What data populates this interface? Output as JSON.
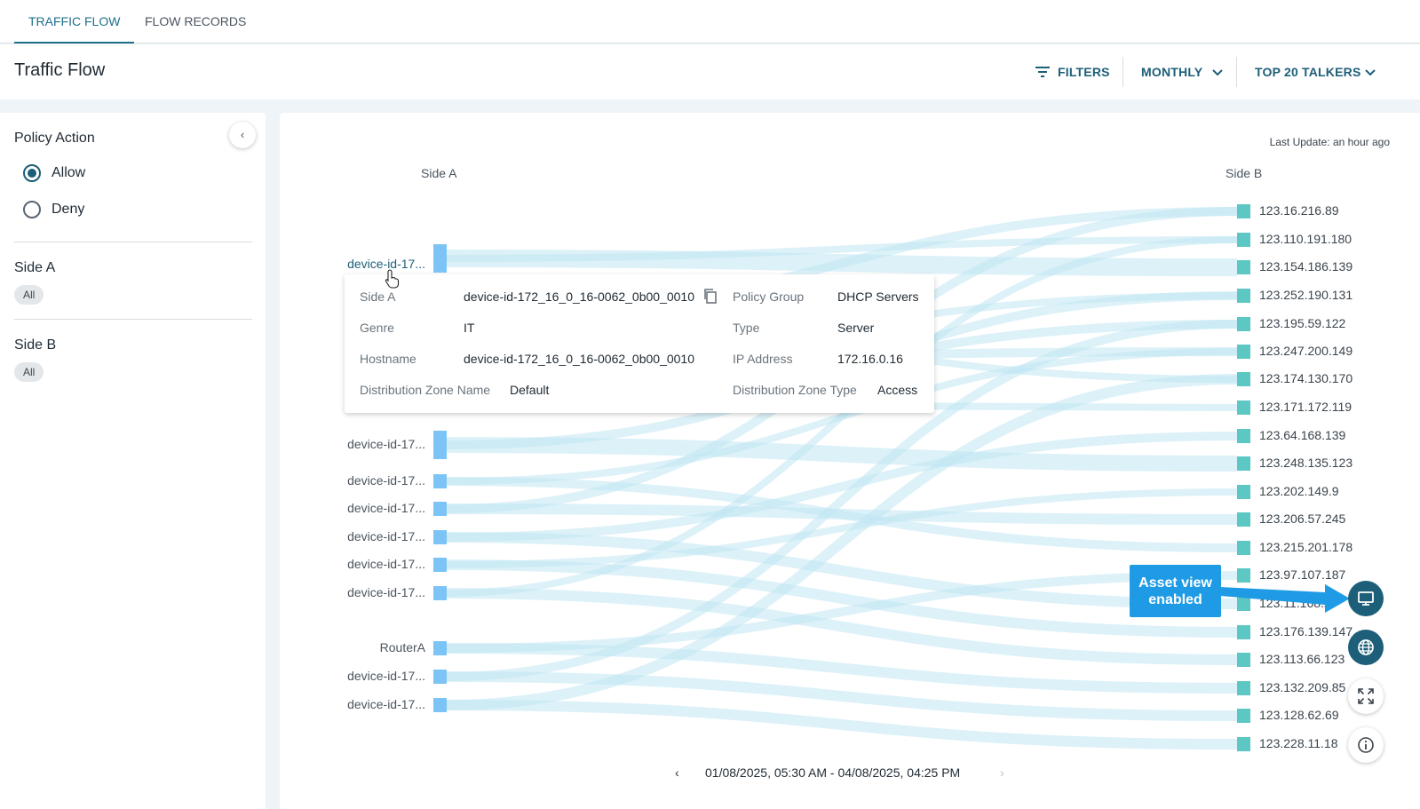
{
  "tabs": [
    {
      "label": "TRAFFIC FLOW",
      "active": true
    },
    {
      "label": "FLOW RECORDS",
      "active": false
    }
  ],
  "header": {
    "title": "Traffic Flow",
    "filters_label": "FILTERS",
    "period_label": "MONTHLY",
    "talkers_label": "TOP 20 TALKERS"
  },
  "sidebar": {
    "policy_action": {
      "title": "Policy Action",
      "options": [
        {
          "label": "Allow",
          "checked": true
        },
        {
          "label": "Deny",
          "checked": false
        }
      ]
    },
    "side_a": {
      "title": "Side A",
      "chip": "All"
    },
    "side_b": {
      "title": "Side B",
      "chip": "All"
    }
  },
  "main": {
    "last_update": "Last Update: an hour ago",
    "side_a_label": "Side A",
    "side_b_label": "Side B",
    "left_nodes": [
      "device-id-17...",
      "device-id-17...",
      "device-id-17...",
      "device-id-17...",
      "device-id-17...",
      "device-id-17...",
      "device-id-17...",
      "RouterA",
      "device-id-17...",
      "device-id-17..."
    ],
    "right_nodes": [
      "123.16.216.89",
      "123.110.191.180",
      "123.154.186.139",
      "123.252.190.131",
      "123.195.59.122",
      "123.247.200.149",
      "123.174.130.170",
      "123.171.172.119",
      "123.64.168.139",
      "123.248.135.123",
      "123.202.149.9",
      "123.206.57.245",
      "123.215.201.178",
      "123.97.107.187",
      "123.11.168.2",
      "123.176.139.147",
      "123.113.66.123",
      "123.132.209.85",
      "123.128.62.69",
      "123.228.11.18"
    ],
    "tooltip": {
      "side_a_key": "Side A",
      "side_a_val": "device-id-172_16_0_16-0062_0b00_0010",
      "policy_group_key": "Policy Group",
      "policy_group_val": "DHCP Servers",
      "genre_key": "Genre",
      "genre_val": "IT",
      "type_key": "Type",
      "type_val": "Server",
      "hostname_key": "Hostname",
      "hostname_val": "device-id-172_16_0_16-0062_0b00_0010",
      "ip_key": "IP Address",
      "ip_val": "172.16.0.16",
      "dz_name_key": "Distribution Zone Name",
      "dz_name_val": "Default",
      "dz_type_key": "Distribution Zone Type",
      "dz_type_val": "Access"
    },
    "callout": "Asset view enabled",
    "date_range": "01/08/2025, 05:30 AM - 04/08/2025, 04:25 PM"
  },
  "colors": {
    "accent": "#1d5f79",
    "left_node": "#7cc4f5",
    "right_node": "#5cc7c3",
    "flow": "#bfe6f3",
    "callout": "#1e9be4"
  }
}
